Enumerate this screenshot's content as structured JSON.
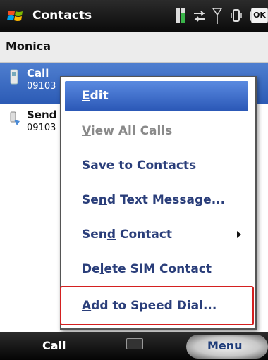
{
  "titlebar": {
    "title": "Contacts",
    "ok_label": "OK",
    "icons": [
      "windows-start-icon",
      "battery-icon",
      "sync-arrows-icon",
      "signal-icon",
      "vibrate-icon",
      "keyboard-icon"
    ]
  },
  "contact": {
    "name": "Monica"
  },
  "list": [
    {
      "title": "Call",
      "number": "09103",
      "icon": "phone-icon",
      "selected": true
    },
    {
      "title": "Send",
      "number": "09103",
      "icon": "message-icon",
      "selected": false
    }
  ],
  "menu": {
    "items": [
      {
        "label": "Edit",
        "ul": "E",
        "rest": "dit",
        "pre": "",
        "state": "highlight"
      },
      {
        "label": "View All Calls",
        "pre": "",
        "ul": "V",
        "rest": "iew All Calls",
        "state": "disabled"
      },
      {
        "label": "Save to Contacts",
        "pre": "",
        "ul": "S",
        "rest": "ave to Contacts",
        "state": "normal"
      },
      {
        "label": "Send Text Message...",
        "pre": "Se",
        "ul": "n",
        "rest": "d Text Message...",
        "state": "normal"
      },
      {
        "label": "Send Contact",
        "pre": "Sen",
        "ul": "d",
        "rest": " Contact",
        "state": "normal",
        "submenu": true
      },
      {
        "label": "Delete SIM Contact",
        "pre": "De",
        "ul": "l",
        "rest": "ete SIM Contact",
        "state": "normal"
      },
      {
        "label": "Add to Speed Dial...",
        "pre": "",
        "ul": "A",
        "rest": "dd to Speed Dial...",
        "state": "normal",
        "emphasized": true
      }
    ]
  },
  "softkeys": {
    "left": "Call",
    "right": "Menu"
  },
  "colors": {
    "highlight": "#2a57b6",
    "callout": "#d42020",
    "menu_text": "#2a3e7a"
  }
}
